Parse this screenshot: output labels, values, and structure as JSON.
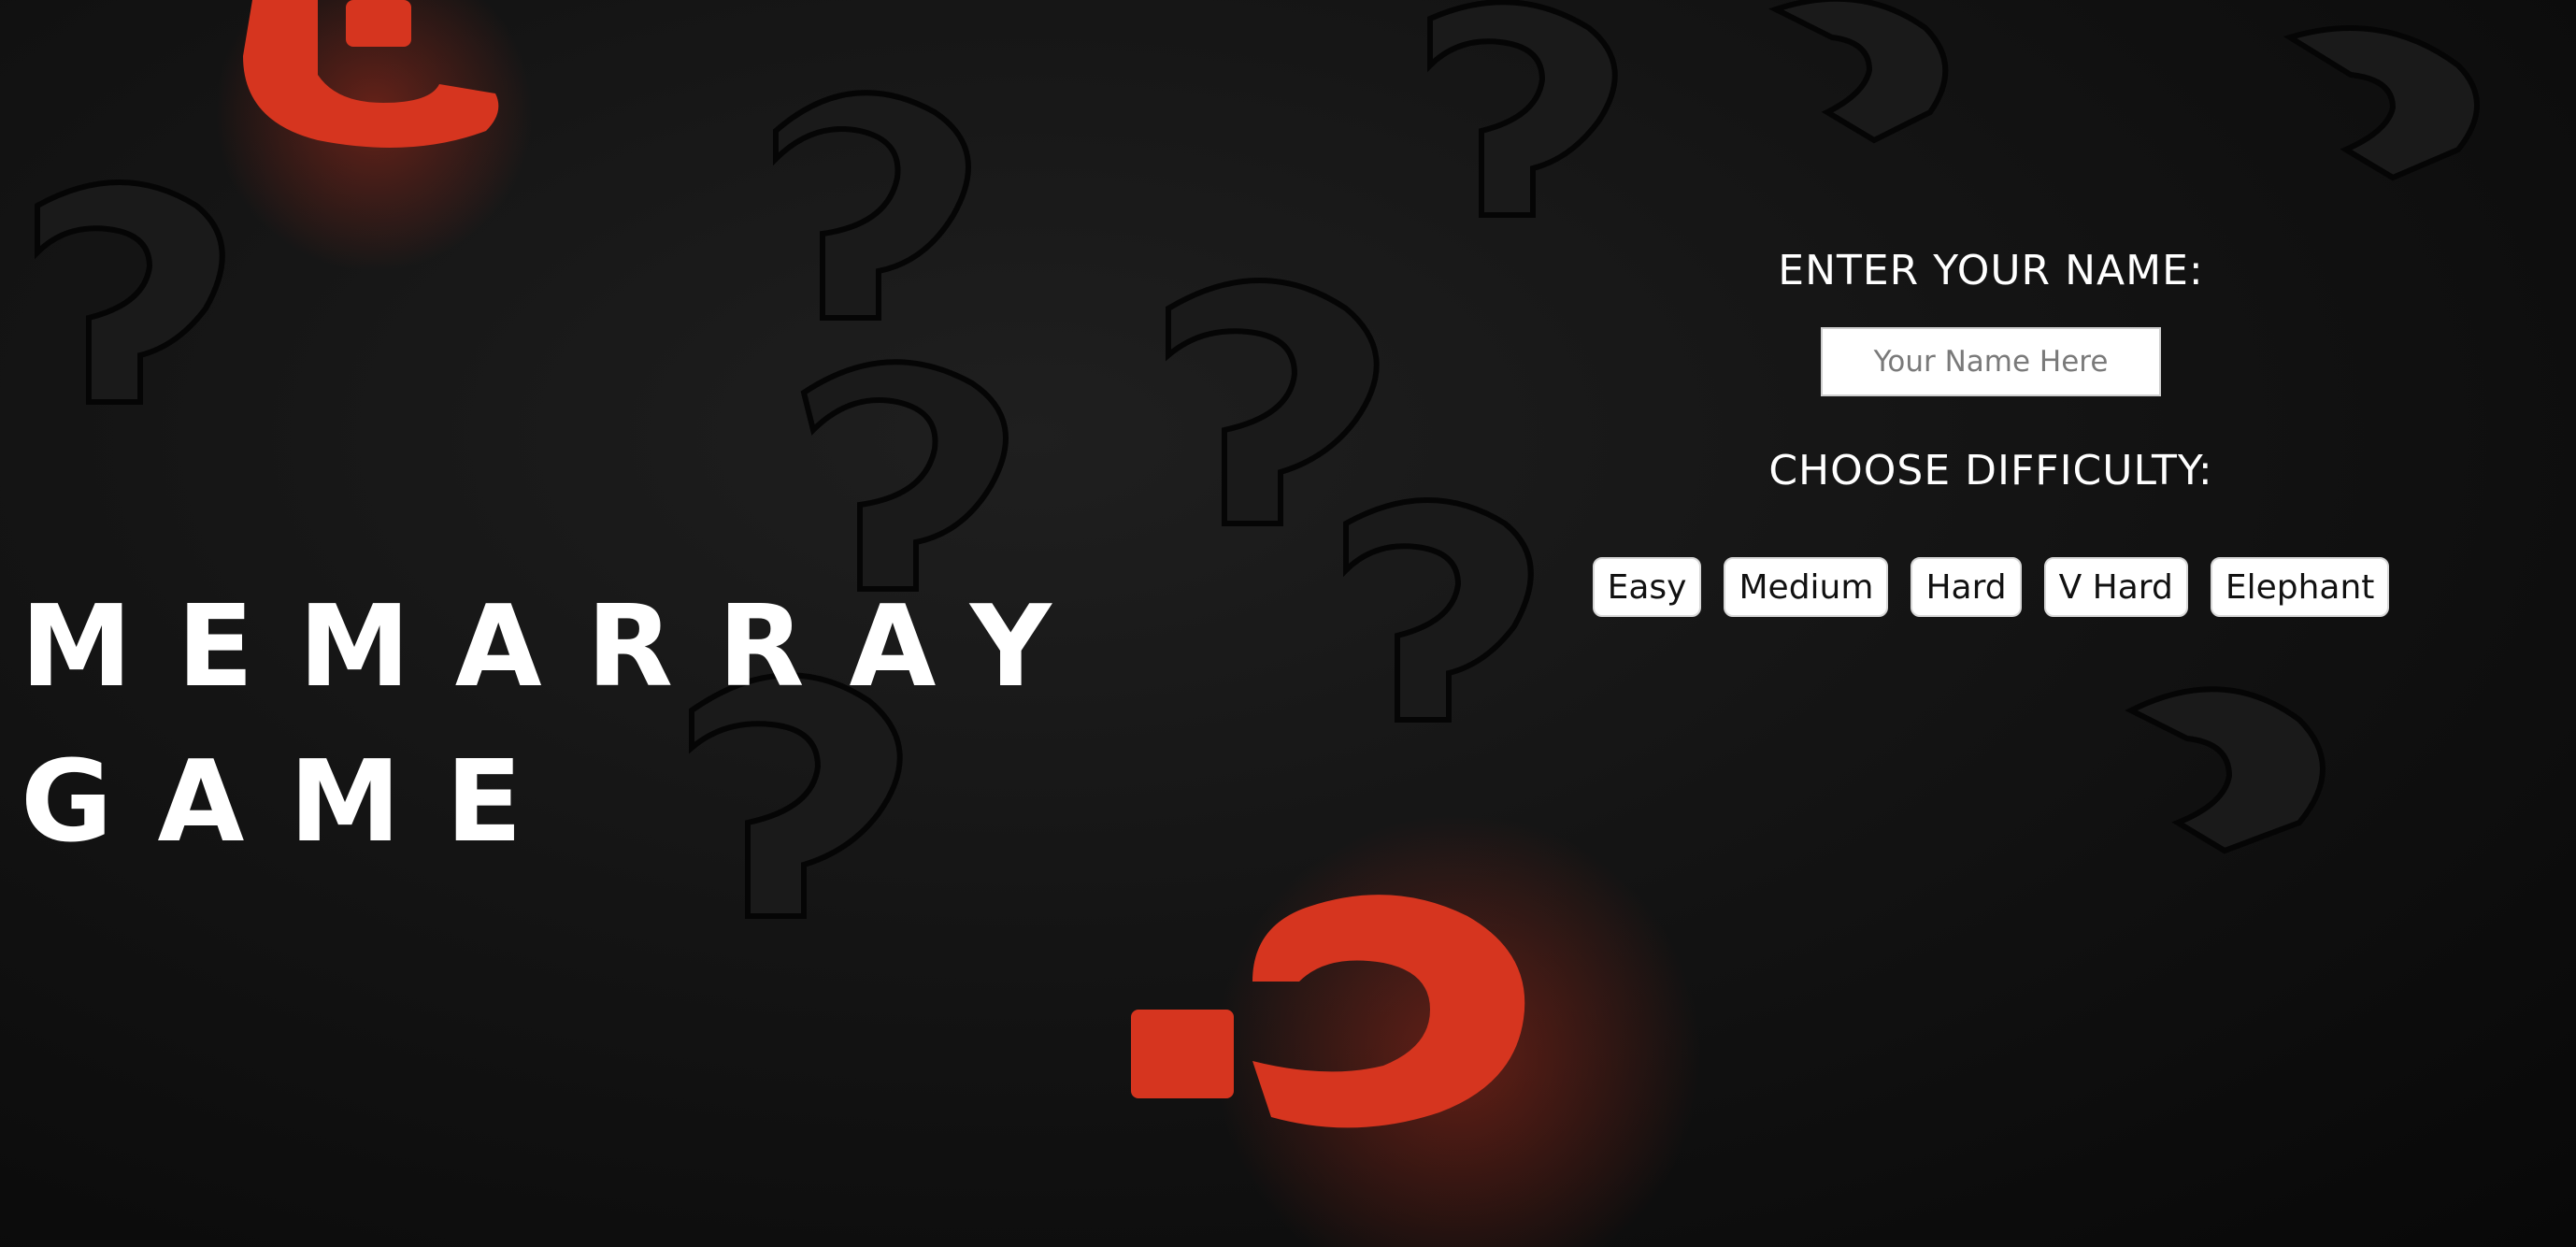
{
  "game": {
    "title_line1": "MEMARRAY",
    "title_line2": "GAME"
  },
  "form": {
    "name_label": "ENTER YOUR NAME:",
    "name_placeholder": "Your Name Here",
    "difficulty_label": "CHOOSE DIFFICULTY:",
    "difficulties": [
      "Easy",
      "Medium",
      "Hard",
      "V Hard",
      "Elephant"
    ]
  },
  "colors": {
    "background": "#111111",
    "accent_red": "#d6351f",
    "text": "#ffffff",
    "button_bg": "#ffffff"
  },
  "background_image": "dark scattered question marks with red question marks"
}
